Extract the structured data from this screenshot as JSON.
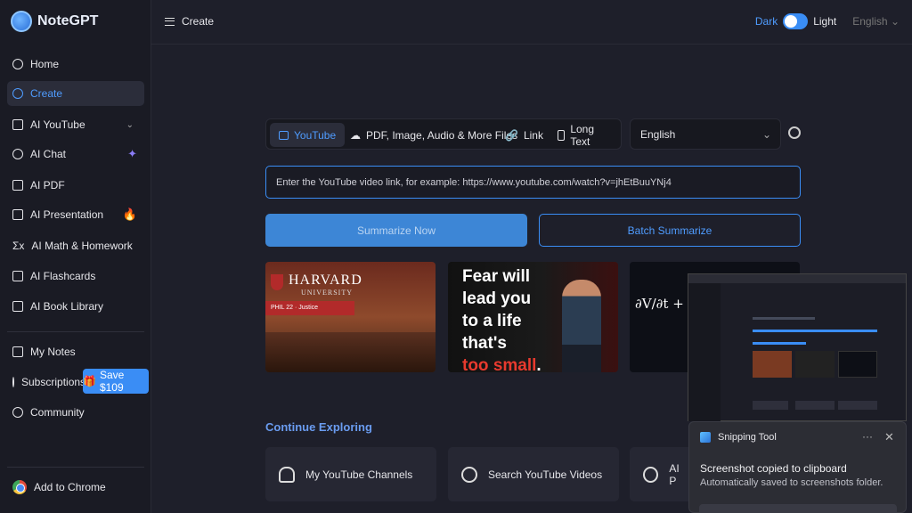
{
  "app": {
    "name": "NoteGPT"
  },
  "sidebar": {
    "items": [
      {
        "label": "Home"
      },
      {
        "label": "Create"
      },
      {
        "label": "AI YouTube"
      },
      {
        "label": "AI Chat"
      },
      {
        "label": "AI PDF"
      },
      {
        "label": "AI Presentation"
      },
      {
        "label": "AI Math & Homework"
      },
      {
        "label": "AI Flashcards"
      },
      {
        "label": "AI Book Library"
      },
      {
        "label": "My Notes"
      },
      {
        "label": "Subscriptions"
      },
      {
        "label": "Community"
      },
      {
        "label": "Add to Chrome"
      }
    ],
    "save_badge": "Save $109",
    "math_icon": "Σx"
  },
  "header": {
    "create_label": "Create",
    "dark_label": "Dark",
    "light_label": "Light",
    "language": "English"
  },
  "main": {
    "tabs": [
      {
        "label": "YouTube"
      },
      {
        "label": "PDF, Image, Audio & More Files"
      },
      {
        "label": "Link"
      },
      {
        "label": "Long Text"
      }
    ],
    "language_select": "English",
    "url_placeholder": "Enter the YouTube video link, for example: https://www.youtube.com/watch?v=jhEtBuuYNj4",
    "summarize_label": "Summarize Now",
    "batch_label": "Batch Summarize",
    "thumbnails": {
      "harvard_title": "HARVARD",
      "harvard_sub": "UNIVERSITY",
      "harvard_course": "PHIL 22 · Justice",
      "fear_lines": [
        "Fear will",
        "lead you",
        "to a life",
        "that's"
      ],
      "fear_red": "too small",
      "equation": "∂V/∂t + rS ∂V/∂S"
    },
    "section_title": "Continue Exploring",
    "explore": [
      {
        "label": "My YouTube Channels"
      },
      {
        "label": "Search YouTube Videos"
      },
      {
        "label": "AI P"
      }
    ]
  },
  "toast": {
    "app": "Snipping Tool",
    "more": "···",
    "close": "✕",
    "message": "Screenshot copied to clipboard",
    "sub": "Automatically saved to screenshots folder."
  },
  "colors": {
    "accent": "#3a8df5",
    "background": "#1e1f2a",
    "sidebar": "#1a1b24"
  }
}
